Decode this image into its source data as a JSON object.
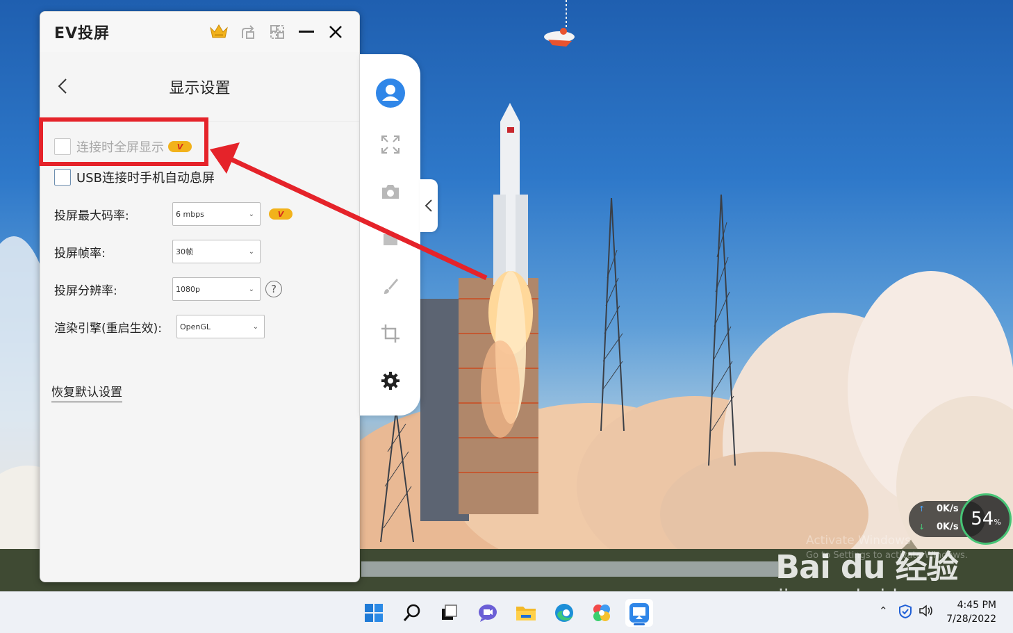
{
  "app": {
    "title": "EV投屏",
    "page_title": "显示设置",
    "checkboxes": [
      {
        "label": "连接时全屏显示",
        "checked": false,
        "disabled": true,
        "vip": true
      },
      {
        "label": "USB连接时手机自动息屏",
        "checked": false,
        "disabled": false,
        "vip": false
      }
    ],
    "settings": {
      "bitrate": {
        "label": "投屏最大码率:",
        "value": "6 mbps",
        "vip": true
      },
      "framerate": {
        "label": "投屏帧率:",
        "value": "30帧"
      },
      "resolution": {
        "label": "投屏分辨率:",
        "value": "1080p"
      },
      "renderer": {
        "label": "渲染引擎(重启生效):",
        "value": "OpenGL"
      }
    },
    "reset_label": "恢复默认设置",
    "vip_badge_text": "V"
  },
  "side_toolbar": {
    "icons": [
      "user-avatar-icon",
      "fullscreen-icon",
      "camera-icon",
      "record-icon",
      "brush-icon",
      "crop-icon",
      "settings-gear-icon"
    ]
  },
  "net_monitor": {
    "upload": "0K/s",
    "download": "0K/s",
    "percent": "54",
    "percent_unit": "%"
  },
  "watermark": {
    "logo": "Bai du 经验",
    "url": "jingyan.baidu.com",
    "activate_line1": "Activate Windows",
    "activate_line2": "Go to Settings to activate Windows."
  },
  "taskbar": {
    "apps": [
      "windows-start-icon",
      "search-icon",
      "task-view-icon",
      "teams-chat-icon",
      "file-explorer-icon",
      "edge-browser-icon",
      "pinwheel-app-icon",
      "ev-screencast-icon"
    ],
    "clock_time": "4:45 PM",
    "clock_date": "7/28/2022"
  },
  "colors": {
    "annotation_red": "#e5232a",
    "accent_blue": "#2f86e8",
    "vip_gold": "#f2b21b"
  }
}
